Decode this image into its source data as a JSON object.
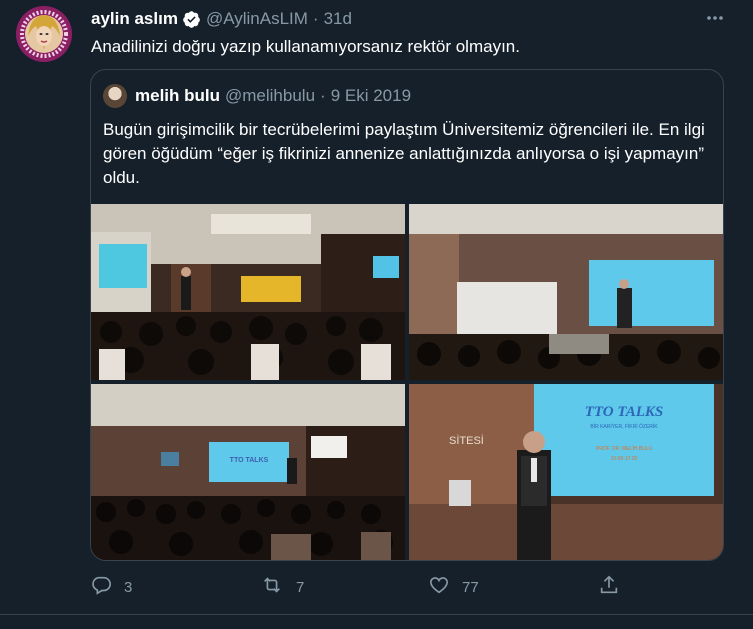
{
  "tweet": {
    "author_name": "aylin aslım",
    "author_handle": "@AylinAsLIM",
    "separator": "·",
    "time": "31d",
    "text": "Anadilinizi doğru yazıp kullanamıyorsanız rektör olmayın."
  },
  "quoted": {
    "author_name": "melih bulu",
    "author_handle": "@melihbulu",
    "separator": "·",
    "time": "9 Eki 2019",
    "text": "Bugün girişimcilik bir tecrübelerimi paylaştım Üniversitemiz öğrencileri ile. En ilgi gören öğüdüm “eğer iş fikrinizi annenize anlattığınızda anlıyorsa o işi yapmayın” oldu."
  },
  "actions": {
    "reply_count": "3",
    "retweet_count": "7",
    "like_count": "77"
  },
  "photos": {
    "p3_screen_text": "TTO TALKS",
    "p4_title": "TTO TALKS",
    "p4_sub1": "BİR KARİYER, FİKRİ ÖZERİK",
    "p4_sub2": "PROF. DR. MELİH BULU",
    "p4_sub3": "15:00-17:30",
    "p4_wall": "SİTESİ"
  },
  "colors": {
    "background": "#15202b",
    "secondary_text": "#8899a6",
    "border": "#38444d",
    "verified": "#ffffff"
  },
  "icons": {
    "verified": "verified-badge-icon",
    "more": "more-icon",
    "reply": "reply-icon",
    "retweet": "retweet-icon",
    "like": "like-icon",
    "share": "share-icon"
  }
}
